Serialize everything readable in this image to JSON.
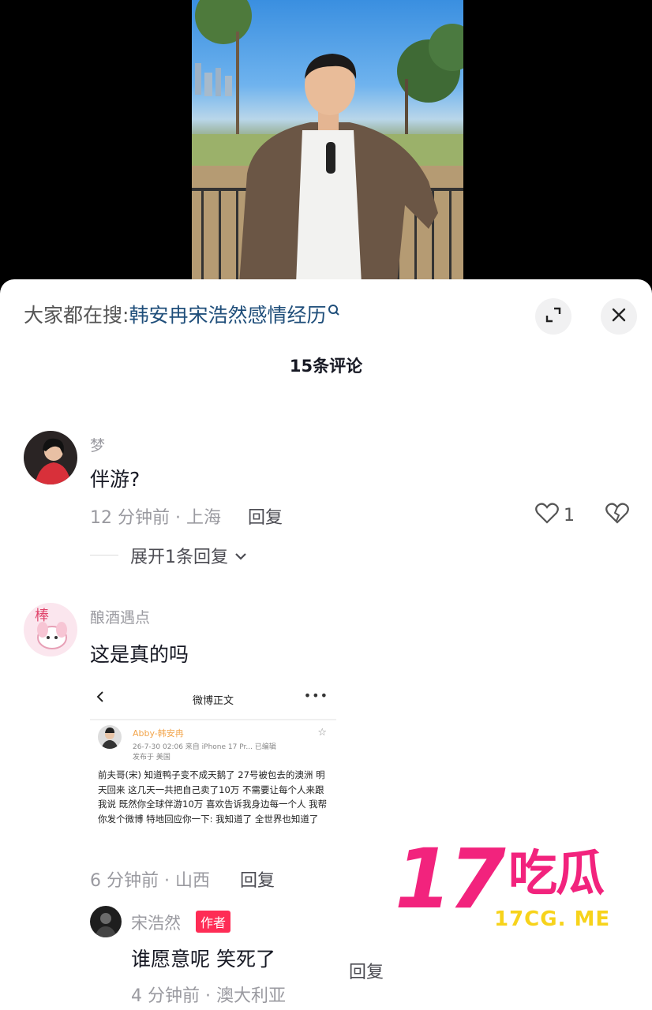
{
  "search": {
    "prefix": "大家都在搜:",
    "term": "韩安冉宋浩然感情经历"
  },
  "header": {
    "comment_count": "15条评论"
  },
  "icons": {
    "search": "search-icon",
    "expand": "expand-icon",
    "close": "close-icon",
    "like": "heart-icon",
    "dislike": "broken-heart-icon",
    "chevron": "chevron-down-icon"
  },
  "comments": [
    {
      "username": "梦",
      "text": "伴游?",
      "time_location": "12 分钟前 · 上海",
      "reply_label": "回复",
      "like_count": "1",
      "expand_label": "展开1条回复"
    },
    {
      "username": "酿酒遇点",
      "text": "这是真的吗",
      "time_location": "6 分钟前 · 山西",
      "reply_label": "回复",
      "embed": {
        "title": "微博正文",
        "user": "Abby-韩安冉",
        "time": "26-7-30 02:06  来自 iPhone 17 Pr...  已编辑",
        "location": "发布于 美国",
        "body": "前夫哥(宋) 知道鸭子变不成天鹅了 27号被包去的澳洲 明天回来 这几天一共把自己卖了10万 不需要让每个人来跟我说 既然你全球伴游10万 喜欢告诉我身边每一个人 我帮你发个微博 特地回应你一下: 我知道了 全世界也知道了"
      }
    }
  ],
  "reply": {
    "username": "宋浩然",
    "author_tag": "作者",
    "text": "谁愿意呢 笑死了",
    "time_location": "4 分钟前 · 澳大利亚",
    "reply_label": "回复"
  },
  "watermark": {
    "big": "17",
    "cn": "吃瓜",
    "url": "17CG. ME"
  },
  "colors": {
    "accent_red": "#fe2c55",
    "watermark_pink": "#f2237d",
    "watermark_yellow": "#f7d31b",
    "search_term": "#1f4e7a"
  }
}
